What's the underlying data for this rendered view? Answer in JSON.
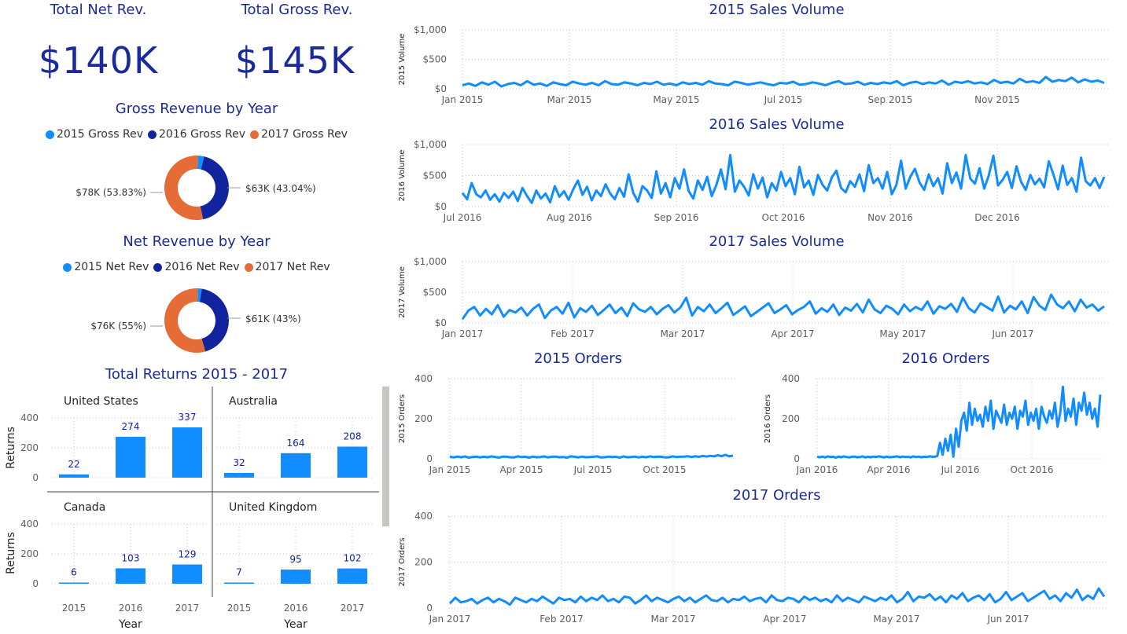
{
  "kpis": {
    "net": {
      "title": "Total Net Rev.",
      "value": "$140K"
    },
    "gross": {
      "title": "Total Gross Rev.",
      "value": "$145K"
    }
  },
  "colors": {
    "c2015": "#118DFF",
    "c2016": "#12239E",
    "c2017": "#E66C37",
    "title": "#1a2a9c",
    "line": "#118DFF",
    "grid": "#c8c8c8"
  },
  "gross_donut": {
    "title": "Gross Revenue by Year",
    "legend": [
      "2015 Gross Rev",
      "2016 Gross Rev",
      "2017 Gross Rev"
    ],
    "label_2016": "$63K (43.04%)",
    "label_2017": "$78K (53.83%)"
  },
  "net_donut": {
    "title": "Net Revenue by Year",
    "legend": [
      "2015 Net Rev",
      "2016 Net Rev",
      "2017 Net Rev"
    ],
    "label_2016": "$61K (43%)",
    "label_2017": "$76K (55%)"
  },
  "returns": {
    "title": "Total Returns 2015 - 2017",
    "ylabel": "Returns",
    "xlabel": "Year",
    "yticks": [
      "0",
      "200",
      "400"
    ]
  },
  "chart_data": [
    {
      "type": "pie",
      "title": "Gross Revenue by Year",
      "categories": [
        "2015 Gross Rev",
        "2016 Gross Rev",
        "2017 Gross Rev"
      ],
      "values": [
        3.13,
        43.04,
        53.83
      ],
      "display_values": [
        "",
        "$63K (43.04%)",
        "$78K (53.83%)"
      ]
    },
    {
      "type": "pie",
      "title": "Net Revenue by Year",
      "categories": [
        "2015 Net Rev",
        "2016 Net Rev",
        "2017 Net Rev"
      ],
      "values": [
        2,
        43,
        55
      ],
      "display_values": [
        "",
        "$61K (43%)",
        "$76K (55%)"
      ]
    },
    {
      "type": "bar",
      "title": "Total Returns 2015 - 2017",
      "xlabel": "Year",
      "ylabel": "Returns",
      "ylim": [
        0,
        400
      ],
      "panels": [
        {
          "name": "United States",
          "categories": [
            "2015",
            "2016",
            "2017"
          ],
          "values": [
            22,
            274,
            337
          ]
        },
        {
          "name": "Australia",
          "categories": [
            "2015",
            "2016",
            "2017"
          ],
          "values": [
            32,
            164,
            208
          ]
        },
        {
          "name": "Canada",
          "categories": [
            "2015",
            "2016",
            "2017"
          ],
          "values": [
            6,
            103,
            129
          ]
        },
        {
          "name": "United Kingdom",
          "categories": [
            "2015",
            "2016",
            "2017"
          ],
          "values": [
            7,
            95,
            102
          ]
        }
      ]
    },
    {
      "type": "line",
      "title": "2015 Sales Volume",
      "ylabel": "2015 Volume",
      "ylim": [
        0,
        1000
      ],
      "yticks": [
        "$0",
        "$500",
        "$1,000"
      ],
      "xticks": [
        "Jan 2015",
        "Mar 2015",
        "May 2015",
        "Jul 2015",
        "Sep 2015",
        "Nov 2015"
      ],
      "x": [
        "2015-01-03",
        "2015-12-31"
      ],
      "y": [
        60,
        90,
        50,
        110,
        70,
        120,
        40,
        80,
        100,
        60,
        130,
        70,
        90,
        50,
        110,
        80,
        60,
        120,
        90,
        70,
        100,
        60,
        130,
        80,
        70,
        110,
        90,
        60,
        100,
        80,
        120,
        70,
        90,
        60,
        110,
        80,
        100,
        70,
        130,
        90,
        80,
        60,
        120,
        100,
        70,
        90,
        110,
        80,
        60,
        100,
        90,
        120,
        70,
        80,
        110,
        90,
        60,
        100,
        130,
        80,
        90,
        120,
        70,
        100,
        80,
        110,
        90,
        130,
        60,
        100,
        120,
        80,
        110,
        90,
        140,
        70,
        120,
        100,
        130,
        90,
        110,
        80,
        150,
        100,
        120,
        90,
        170,
        110,
        130,
        100,
        200,
        120,
        150,
        130,
        190,
        110,
        160,
        120,
        140,
        100
      ]
    },
    {
      "type": "line",
      "title": "2016 Sales Volume",
      "ylabel": "2016 Volume",
      "ylim": [
        0,
        1000
      ],
      "yticks": [
        "$0",
        "$500",
        "$1,000"
      ],
      "xticks": [
        "Jul 2016",
        "Aug 2016",
        "Sep 2016",
        "Oct 2016",
        "Nov 2016",
        "Dec 2016"
      ],
      "x": [
        "2016-07-01",
        "2016-12-31"
      ],
      "y": [
        220,
        120,
        380,
        200,
        150,
        260,
        110,
        200,
        80,
        220,
        140,
        240,
        90,
        300,
        170,
        60,
        260,
        130,
        210,
        70,
        330,
        160,
        250,
        110,
        280,
        420,
        190,
        320,
        100,
        260,
        170,
        360,
        210,
        120,
        300,
        160,
        520,
        220,
        80,
        330,
        260,
        140,
        570,
        210,
        380,
        150,
        460,
        290,
        600,
        250,
        130,
        420,
        270,
        480,
        170,
        350,
        600,
        280,
        830,
        240,
        420,
        320,
        180,
        520,
        290,
        470,
        150,
        380,
        260,
        560,
        330,
        460,
        200,
        640,
        310,
        420,
        190,
        510,
        350,
        260,
        470,
        580,
        300,
        230,
        410,
        320,
        520,
        250,
        670,
        380,
        460,
        290,
        560,
        200,
        350,
        740,
        290,
        480,
        610,
        390,
        270,
        520,
        330,
        460,
        210,
        700,
        380,
        550,
        290,
        830,
        450,
        370,
        620,
        290,
        500,
        820,
        340,
        430,
        560,
        300,
        650,
        400,
        270,
        510,
        360,
        450,
        310,
        730,
        520,
        280,
        660,
        350,
        460,
        240,
        790,
        410,
        340,
        460,
        300,
        480
      ]
    },
    {
      "type": "line",
      "title": "2017 Sales Volume",
      "ylabel": "2017 Volume",
      "ylim": [
        0,
        1000
      ],
      "yticks": [
        "$0",
        "$500",
        "$1,000"
      ],
      "xticks": [
        "Jan 2017",
        "Feb 2017",
        "Mar 2017",
        "Apr 2017",
        "May 2017",
        "Jun 2017"
      ],
      "x": [
        "2017-01-01",
        "2017-07-31"
      ],
      "y": [
        60,
        200,
        260,
        120,
        230,
        140,
        290,
        100,
        210,
        170,
        250,
        120,
        230,
        300,
        80,
        200,
        260,
        150,
        330,
        90,
        240,
        180,
        280,
        130,
        210,
        300,
        160,
        250,
        110,
        320,
        220,
        180,
        260,
        140,
        230,
        290,
        170,
        250,
        410,
        120,
        260,
        190,
        300,
        160,
        240,
        330,
        130,
        200,
        270,
        110,
        180,
        250,
        320,
        160,
        220,
        290,
        140,
        210,
        260,
        350,
        150,
        240,
        180,
        300,
        130,
        250,
        200,
        310,
        170,
        380,
        220,
        160,
        280,
        230,
        140,
        300,
        190,
        260,
        210,
        350,
        150,
        270,
        230,
        310,
        180,
        410,
        240,
        170,
        320,
        260,
        200,
        430,
        170,
        280,
        220,
        350,
        160,
        420,
        280,
        210,
        460,
        300,
        240,
        350,
        190,
        380,
        250,
        300,
        200,
        270
      ]
    },
    {
      "type": "line",
      "title": "2015 Orders",
      "ylabel": "2015 Orders",
      "ylim": [
        0,
        400
      ],
      "yticks": [
        "0",
        "200",
        "400"
      ],
      "xticks": [
        "Jan 2015",
        "Apr 2015",
        "Jul 2015",
        "Oct 2015"
      ],
      "x": [
        "2015-01-01",
        "2015-12-31"
      ],
      "y": [
        10,
        7,
        11,
        8,
        12,
        6,
        9,
        11,
        7,
        10,
        8,
        12,
        9,
        6,
        11,
        10,
        8,
        7,
        12,
        9,
        10,
        6,
        11,
        8,
        9,
        12,
        7,
        10,
        11,
        8,
        9,
        6,
        12,
        10,
        7,
        11,
        8,
        9,
        10,
        12,
        7,
        8,
        11,
        9,
        10,
        6,
        12,
        8,
        9,
        11,
        7,
        10,
        8,
        12,
        9,
        11,
        10,
        7,
        8,
        12,
        9,
        10,
        11,
        13,
        9,
        12,
        10,
        14,
        11,
        15,
        12,
        18,
        13,
        20,
        12,
        16
      ]
    },
    {
      "type": "line",
      "title": "2016 Orders",
      "ylabel": "2016 Orders",
      "ylim": [
        0,
        400
      ],
      "yticks": [
        "0",
        "200",
        "400"
      ],
      "xticks": [
        "Jan 2016",
        "Apr 2016",
        "Jul 2016",
        "Oct 2016"
      ],
      "x": [
        "2016-01-01",
        "2016-12-31"
      ],
      "y": [
        10,
        8,
        11,
        7,
        12,
        9,
        10,
        6,
        11,
        8,
        12,
        9,
        7,
        10,
        11,
        8,
        9,
        12,
        7,
        10,
        8,
        11,
        9,
        12,
        10,
        7,
        11,
        8,
        9,
        10,
        12,
        8,
        11,
        9,
        10,
        7,
        12,
        9,
        11,
        8,
        10,
        9,
        12,
        11,
        10,
        14,
        80,
        20,
        100,
        40,
        120,
        10,
        150,
        60,
        190,
        230,
        140,
        280,
        170,
        250,
        190,
        220,
        160,
        260,
        190,
        290,
        150,
        240,
        210,
        180,
        270,
        170,
        230,
        200,
        260,
        150,
        240,
        210,
        290,
        170,
        230,
        190,
        250,
        150,
        260,
        210,
        180,
        240,
        200,
        280,
        160,
        230,
        360,
        190,
        250,
        210,
        300,
        170,
        280,
        240,
        330,
        220,
        280,
        200,
        250,
        160,
        320
      ]
    },
    {
      "type": "line",
      "title": "2017 Orders",
      "ylabel": "2017 Orders",
      "ylim": [
        0,
        400
      ],
      "yticks": [
        "0",
        "200",
        "400"
      ],
      "xticks": [
        "Jan 2017",
        "Feb 2017",
        "Mar 2017",
        "Apr 2017",
        "May 2017",
        "Jun 2017"
      ],
      "x": [
        "2017-01-01",
        "2017-07-31"
      ],
      "y": [
        20,
        45,
        25,
        30,
        40,
        20,
        35,
        45,
        25,
        40,
        30,
        15,
        45,
        35,
        25,
        40,
        30,
        50,
        35,
        20,
        45,
        35,
        40,
        25,
        50,
        30,
        45,
        35,
        55,
        30,
        40,
        25,
        50,
        45,
        20,
        35,
        55,
        30,
        45,
        35,
        25,
        40,
        50,
        30,
        45,
        25,
        40,
        55,
        35,
        30,
        45,
        25,
        40,
        35,
        50,
        30,
        40,
        45,
        25,
        55,
        35,
        30,
        45,
        40,
        25,
        50,
        35,
        45,
        30,
        40,
        25,
        55,
        30,
        45,
        35,
        25,
        50,
        40,
        30,
        45,
        35,
        55,
        25,
        40,
        70,
        30,
        50,
        45,
        60,
        35,
        50,
        25,
        55,
        40,
        65,
        30,
        45,
        55,
        35,
        60,
        25,
        40,
        70,
        35,
        50,
        65,
        30,
        45,
        60,
        75,
        40,
        55,
        30,
        65,
        45,
        80,
        35,
        55,
        40,
        85,
        50
      ]
    }
  ]
}
